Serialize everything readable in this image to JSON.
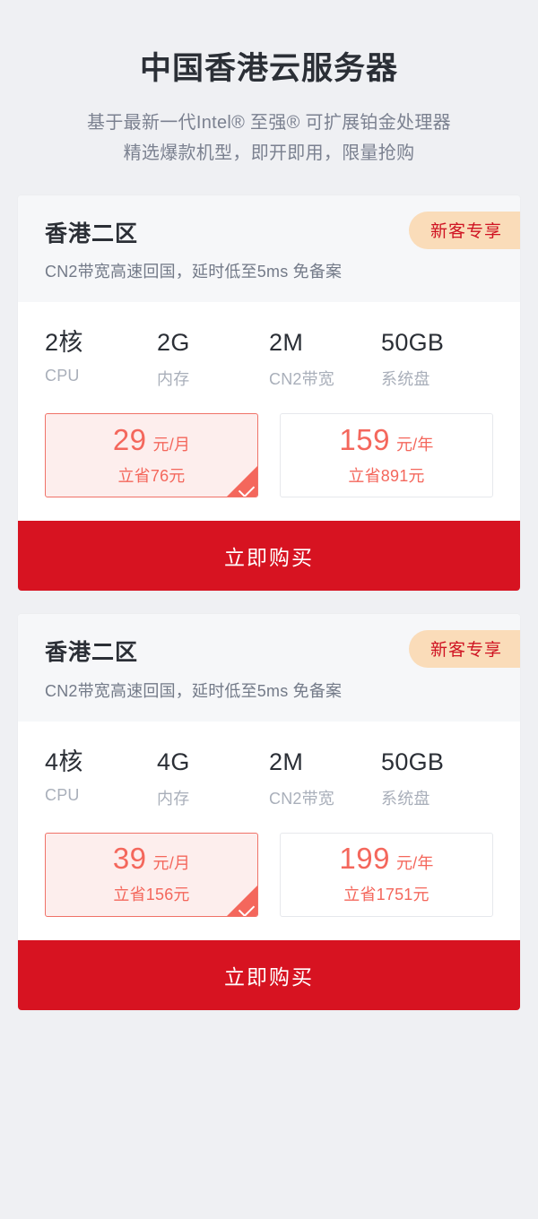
{
  "hero": {
    "title": "中国香港云服务器",
    "subtitle_lines": [
      "基于最新一代Intel® 至强® 可扩展铂金处理器",
      "精选爆款机型，即开即用，限量抢购"
    ]
  },
  "theme": {
    "page_background": "#eff0f3",
    "card_background": "#ffffff",
    "card_header_background": "#f6f7f9",
    "badge_background": "#fadcb9",
    "badge_text": "#cf1322",
    "price_accent": "#f4675c",
    "price_selected_background": "#fdeeed",
    "buy_button_background": "#d71321",
    "heading_text": "#2b2f36",
    "muted_text": "#a9afba"
  },
  "cards": [
    {
      "region": "香港二区",
      "description": "CN2带宽高速回国，延时低至5ms 免备案",
      "badge": "新客专享",
      "specs": [
        {
          "value": "2核",
          "label": "CPU"
        },
        {
          "value": "2G",
          "label": "内存"
        },
        {
          "value": "2M",
          "label": "CN2带宽"
        },
        {
          "value": "50GB",
          "label": "系统盘"
        }
      ],
      "prices": [
        {
          "amount": "29",
          "unit": "元/月",
          "save": "立省76元",
          "selected": true
        },
        {
          "amount": "159",
          "unit": "元/年",
          "save": "立省891元",
          "selected": false
        }
      ],
      "buy_label": "立即购买"
    },
    {
      "region": "香港二区",
      "description": "CN2带宽高速回国，延时低至5ms 免备案",
      "badge": "新客专享",
      "specs": [
        {
          "value": "4核",
          "label": "CPU"
        },
        {
          "value": "4G",
          "label": "内存"
        },
        {
          "value": "2M",
          "label": "CN2带宽"
        },
        {
          "value": "50GB",
          "label": "系统盘"
        }
      ],
      "prices": [
        {
          "amount": "39",
          "unit": "元/月",
          "save": "立省156元",
          "selected": true
        },
        {
          "amount": "199",
          "unit": "元/年",
          "save": "立省1751元",
          "selected": false
        }
      ],
      "buy_label": "立即购买"
    }
  ]
}
